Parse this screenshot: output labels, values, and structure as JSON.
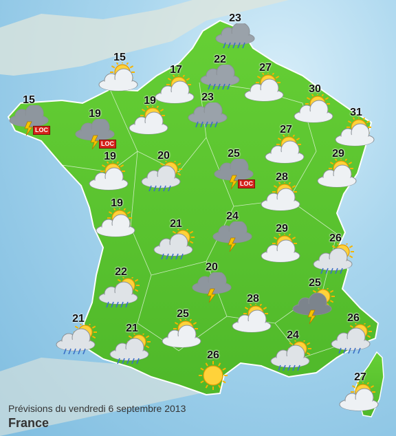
{
  "footer": {
    "date": "Prévisions du vendredi 6 septembre 2013",
    "title": "France"
  },
  "badge_label": "LOC",
  "colors": {
    "land": "#5ec92f",
    "sea": "#a9d6ee",
    "sun": "#f6b400",
    "cloud": "#e9ecef",
    "rain": "#3a6fc6"
  },
  "stations": [
    {
      "temp": "23",
      "icon": "rain-cloud-icon",
      "badge": false
    },
    {
      "temp": "15",
      "icon": "sun-cloud-icon",
      "badge": false
    },
    {
      "temp": "22",
      "icon": "rain-cloud-icon",
      "badge": false
    },
    {
      "temp": "17",
      "icon": "sun-cloud-icon",
      "badge": false
    },
    {
      "temp": "27",
      "icon": "sun-cloud-icon",
      "badge": false
    },
    {
      "temp": "15",
      "icon": "storm-icon",
      "badge": true
    },
    {
      "temp": "19",
      "icon": "storm-icon",
      "badge": true
    },
    {
      "temp": "19",
      "icon": "sun-cloud-icon",
      "badge": false
    },
    {
      "temp": "23",
      "icon": "rain-cloud-icon",
      "badge": false
    },
    {
      "temp": "30",
      "icon": "sun-cloud-icon",
      "badge": false
    },
    {
      "temp": "31",
      "icon": "sun-cloud-icon",
      "badge": false
    },
    {
      "temp": "27",
      "icon": "sun-cloud-icon",
      "badge": false
    },
    {
      "temp": "19",
      "icon": "sun-cloud-icon",
      "badge": false
    },
    {
      "temp": "20",
      "icon": "sun-rain-icon",
      "badge": false
    },
    {
      "temp": "25",
      "icon": "storm-icon",
      "badge": true
    },
    {
      "temp": "29",
      "icon": "sun-cloud-icon",
      "badge": false
    },
    {
      "temp": "28",
      "icon": "sun-cloud-icon",
      "badge": false
    },
    {
      "temp": "19",
      "icon": "sun-cloud-icon",
      "badge": false
    },
    {
      "temp": "21",
      "icon": "sun-rain-icon",
      "badge": false
    },
    {
      "temp": "24",
      "icon": "storm-icon",
      "badge": false
    },
    {
      "temp": "29",
      "icon": "sun-cloud-icon",
      "badge": false
    },
    {
      "temp": "26",
      "icon": "sun-rain-icon",
      "badge": false
    },
    {
      "temp": "22",
      "icon": "sun-rain-icon",
      "badge": false
    },
    {
      "temp": "20",
      "icon": "storm-icon",
      "badge": false
    },
    {
      "temp": "25",
      "icon": "sun-storm-icon",
      "badge": false
    },
    {
      "temp": "28",
      "icon": "sun-cloud-icon",
      "badge": false
    },
    {
      "temp": "21",
      "icon": "sun-rain-icon",
      "badge": false
    },
    {
      "temp": "21",
      "icon": "sun-rain-icon",
      "badge": false
    },
    {
      "temp": "25",
      "icon": "sun-cloud-icon",
      "badge": false
    },
    {
      "temp": "24",
      "icon": "sun-rain-icon",
      "badge": false
    },
    {
      "temp": "26",
      "icon": "sun-rain-icon",
      "badge": false
    },
    {
      "temp": "26",
      "icon": "sun-icon",
      "badge": false
    },
    {
      "temp": "27",
      "icon": "sun-cloud-icon",
      "badge": false
    }
  ]
}
